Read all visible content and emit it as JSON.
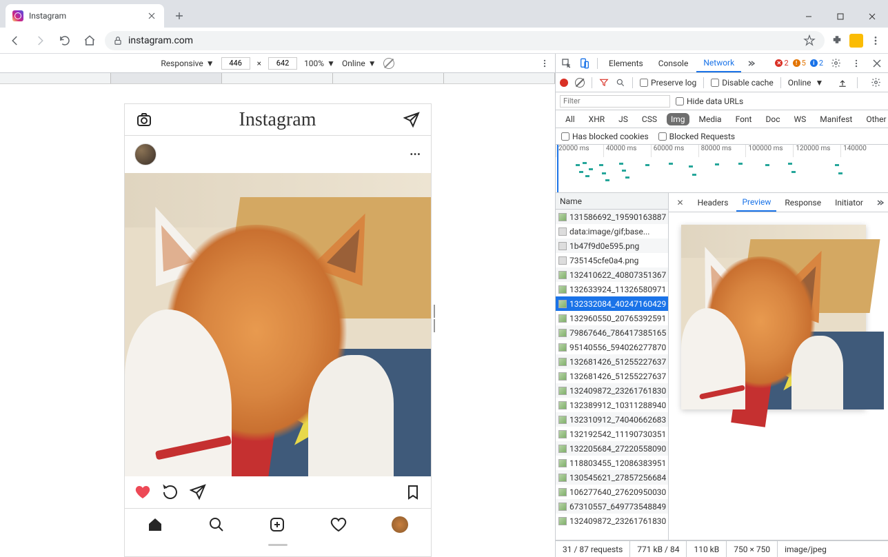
{
  "browser": {
    "tab_title": "Instagram",
    "url": "instagram.com"
  },
  "device_bar": {
    "mode": "Responsive",
    "width": "446",
    "height": "642",
    "zoom": "100%",
    "throttle": "Online"
  },
  "instagram": {
    "logo": "Instagram"
  },
  "devtools": {
    "tabs": [
      "Elements",
      "Console",
      "Network"
    ],
    "active_tab": "Network",
    "badges": {
      "errors": "2",
      "warnings": "5",
      "info": "2"
    },
    "toolbar": {
      "preserve_log": "Preserve log",
      "disable_cache": "Disable cache",
      "throttle": "Online"
    },
    "filter_placeholder": "Filter",
    "hide_data_urls": "Hide data URLs",
    "types": [
      "All",
      "XHR",
      "JS",
      "CSS",
      "Img",
      "Media",
      "Font",
      "Doc",
      "WS",
      "Manifest",
      "Other"
    ],
    "active_type": "Img",
    "blocked_cookies": "Has blocked cookies",
    "blocked_requests": "Blocked Requests",
    "timeline_ticks": [
      "20000 ms",
      "40000 ms",
      "60000 ms",
      "80000 ms",
      "100000 ms",
      "120000 ms",
      "140000"
    ],
    "name_header": "Name",
    "requests": [
      "131586692_19590163887",
      "data:image/gif;base...",
      "1b47f9d0e595.png",
      "735145cfe0a4.png",
      "132410622_40807351367",
      "132633924_11326580971",
      "132332084_40247160429",
      "132960550_20765392591",
      "79867646_786417385165",
      "95140556_594026277870",
      "132681426_51255227637",
      "132681426_51255227637",
      "132409872_23261761830",
      "132389912_10311288940",
      "132310912_74040662683",
      "132192542_11190730351",
      "132205684_27220558090",
      "118803455_12086383951",
      "130545621_27857256684",
      "106277640_27620950030",
      "67310557_649773548849",
      "132409872_23261761830"
    ],
    "selected_index": 6,
    "detail_tabs": [
      "Headers",
      "Preview",
      "Response",
      "Initiator"
    ],
    "active_detail_tab": "Preview",
    "status": {
      "requests": "31 / 87 requests",
      "transferred": "771 kB / 84",
      "resources": "110 kB",
      "dimensions": "750 × 750",
      "mime": "image/jpeg"
    }
  }
}
